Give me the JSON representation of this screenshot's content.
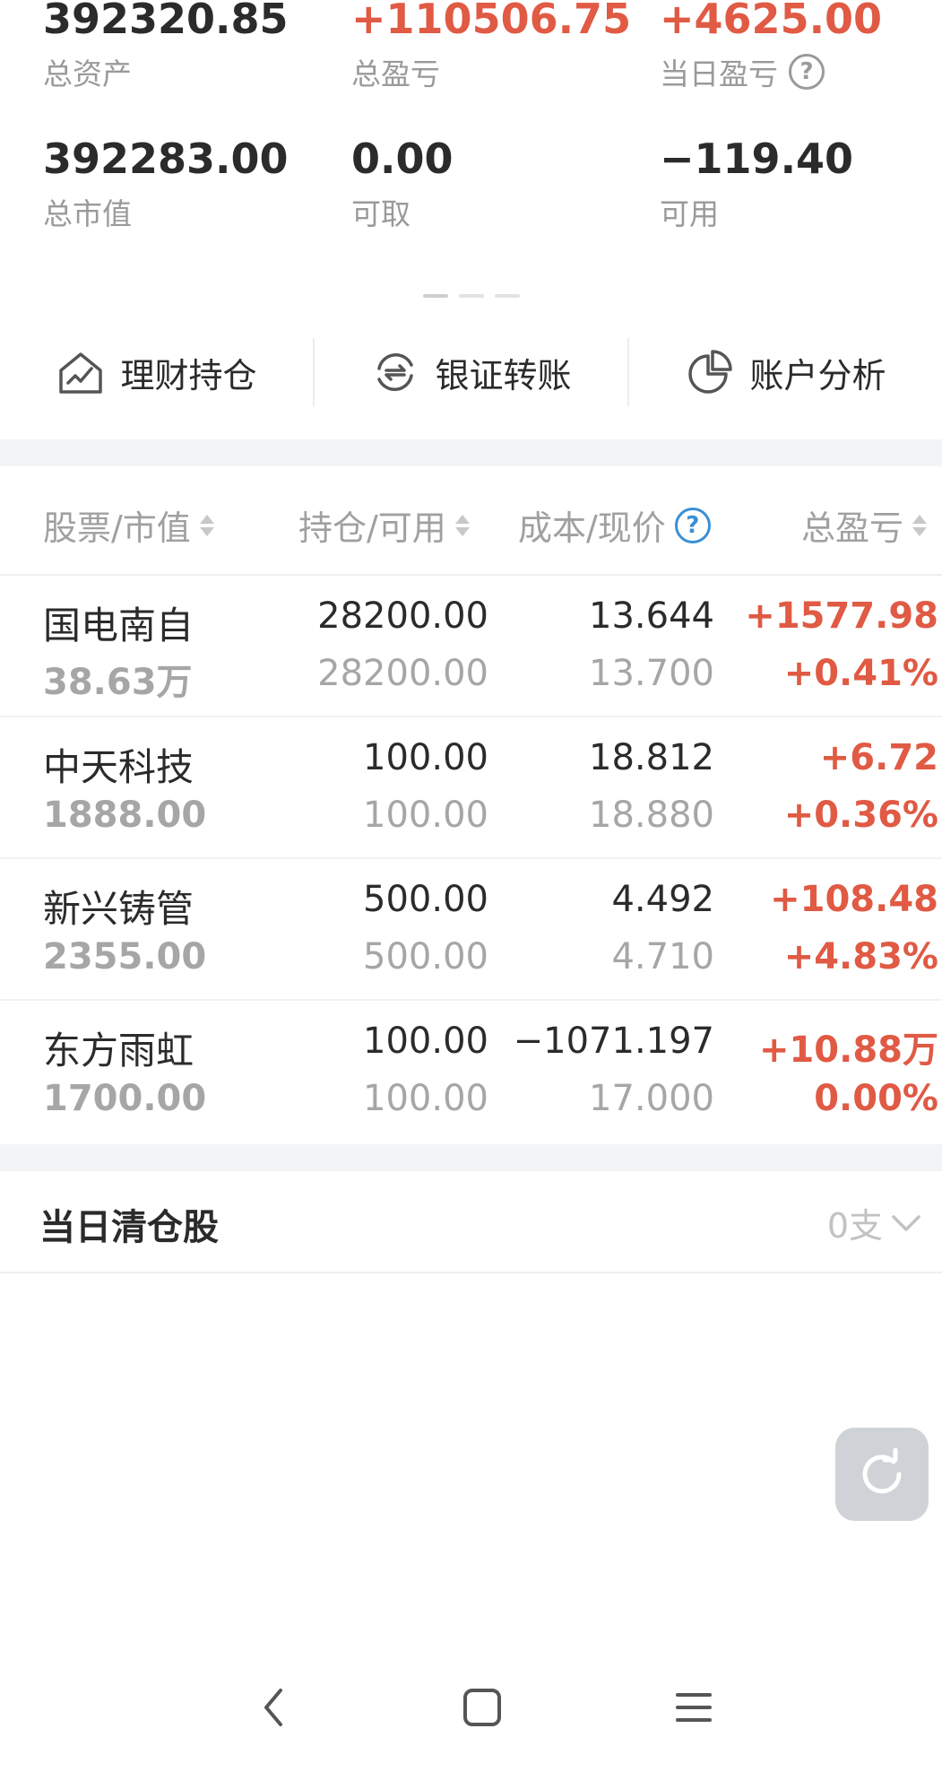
{
  "summary": {
    "total_assets": {
      "value": "392320.85",
      "label": "总资产"
    },
    "total_pnl": {
      "value": "+110506.75",
      "label": "总盈亏"
    },
    "daily_pnl": {
      "value": "+4625.00",
      "label": "当日盈亏",
      "help": "?"
    },
    "market_value": {
      "value": "392283.00",
      "label": "总市值"
    },
    "withdrawable": {
      "value": "0.00",
      "label": "可取"
    },
    "available": {
      "value": "−119.40",
      "label": "可用"
    }
  },
  "quick_actions": [
    {
      "label": "理财持仓",
      "icon": "house-chart-icon"
    },
    {
      "label": "银证转账",
      "icon": "transfer-cycle-icon"
    },
    {
      "label": "账户分析",
      "icon": "pie-chart-icon"
    }
  ],
  "table": {
    "headers": {
      "stock": "股票/市值",
      "position": "持仓/可用",
      "cost": "成本/现价",
      "pnl": "总盈亏",
      "cost_help": "?"
    },
    "rows": [
      {
        "name": "国电南自",
        "market_value": "38.63万",
        "holding": "28200.00",
        "available": "28200.00",
        "cost": "13.644",
        "price": "13.700",
        "pnl": "+1577.98",
        "pnl_pct": "+0.41%"
      },
      {
        "name": "中天科技",
        "market_value": "1888.00",
        "holding": "100.00",
        "available": "100.00",
        "cost": "18.812",
        "price": "18.880",
        "pnl": "+6.72",
        "pnl_pct": "+0.36%"
      },
      {
        "name": "新兴铸管",
        "market_value": "2355.00",
        "holding": "500.00",
        "available": "500.00",
        "cost": "4.492",
        "price": "4.710",
        "pnl": "+108.48",
        "pnl_pct": "+4.83%"
      },
      {
        "name": "东方雨虹",
        "market_value": "1700.00",
        "holding": "100.00",
        "available": "100.00",
        "cost": "−1071.197",
        "price": "17.000",
        "pnl": "+10.88万",
        "pnl_pct": "0.00%"
      }
    ]
  },
  "cleared": {
    "title": "当日清仓股",
    "count": "0支"
  },
  "colors": {
    "gain": "#e05a44",
    "text": "#2b2b2b",
    "muted": "#9a9a9a",
    "accent": "#3a8fd6",
    "band": "#f2f4f6"
  },
  "icons": {
    "refresh": "refresh-icon",
    "back": "back-icon",
    "home": "home-icon",
    "menu": "menu-icon"
  }
}
